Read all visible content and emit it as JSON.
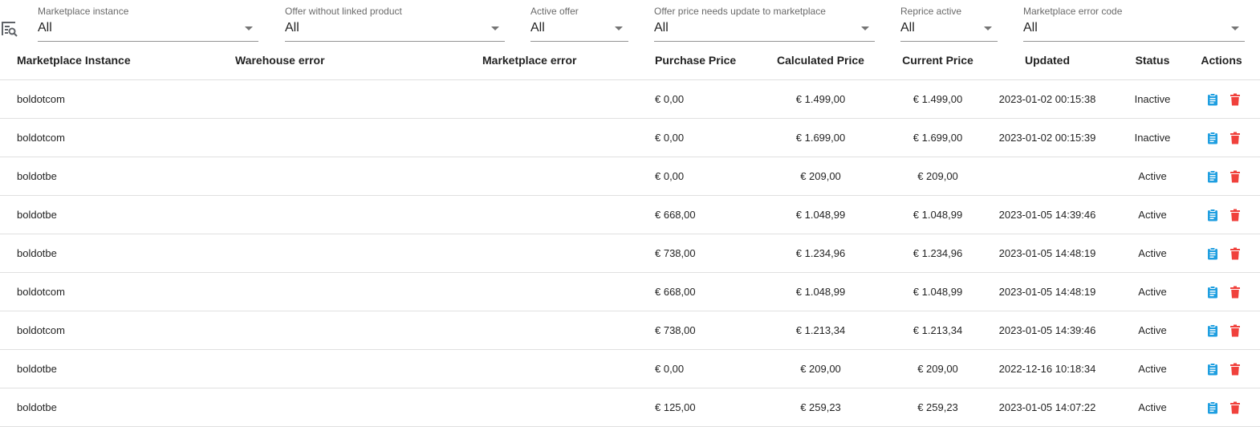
{
  "filters": [
    {
      "label": "Marketplace instance",
      "value": "All"
    },
    {
      "label": "Offer without linked product",
      "value": "All"
    },
    {
      "label": "Active offer",
      "value": "All"
    },
    {
      "label": "Offer price needs update to marketplace",
      "value": "All"
    },
    {
      "label": "Reprice active",
      "value": "All"
    },
    {
      "label": "Marketplace error code",
      "value": "All"
    }
  ],
  "table": {
    "headers": {
      "instance": "Marketplace Instance",
      "warehouse_error": "Warehouse error",
      "marketplace_error": "Marketplace error",
      "purchase_price": "Purchase Price",
      "calculated_price": "Calculated Price",
      "current_price": "Current Price",
      "updated": "Updated",
      "status": "Status",
      "actions": "Actions"
    },
    "rows": [
      {
        "instance": "boldotcom",
        "warehouse_error": "",
        "marketplace_error": "",
        "purchase_price": "€ 0,00",
        "calculated_price": "€ 1.499,00",
        "current_price": "€ 1.499,00",
        "updated": "2023-01-02 00:15:38",
        "status": "Inactive"
      },
      {
        "instance": "boldotcom",
        "warehouse_error": "",
        "marketplace_error": "",
        "purchase_price": "€ 0,00",
        "calculated_price": "€ 1.699,00",
        "current_price": "€ 1.699,00",
        "updated": "2023-01-02 00:15:39",
        "status": "Inactive"
      },
      {
        "instance": "boldotbe",
        "warehouse_error": "",
        "marketplace_error": "",
        "purchase_price": "€ 0,00",
        "calculated_price": "€ 209,00",
        "current_price": "€ 209,00",
        "updated": "",
        "status": "Active"
      },
      {
        "instance": "boldotbe",
        "warehouse_error": "",
        "marketplace_error": "",
        "purchase_price": "€ 668,00",
        "calculated_price": "€ 1.048,99",
        "current_price": "€ 1.048,99",
        "updated": "2023-01-05 14:39:46",
        "status": "Active"
      },
      {
        "instance": "boldotbe",
        "warehouse_error": "",
        "marketplace_error": "",
        "purchase_price": "€ 738,00",
        "calculated_price": "€ 1.234,96",
        "current_price": "€ 1.234,96",
        "updated": "2023-01-05 14:48:19",
        "status": "Active"
      },
      {
        "instance": "boldotcom",
        "warehouse_error": "",
        "marketplace_error": "",
        "purchase_price": "€ 668,00",
        "calculated_price": "€ 1.048,99",
        "current_price": "€ 1.048,99",
        "updated": "2023-01-05 14:48:19",
        "status": "Active"
      },
      {
        "instance": "boldotcom",
        "warehouse_error": "",
        "marketplace_error": "",
        "purchase_price": "€ 738,00",
        "calculated_price": "€ 1.213,34",
        "current_price": "€ 1.213,34",
        "updated": "2023-01-05 14:39:46",
        "status": "Active"
      },
      {
        "instance": "boldotbe",
        "warehouse_error": "",
        "marketplace_error": "",
        "purchase_price": "€ 0,00",
        "calculated_price": "€ 209,00",
        "current_price": "€ 209,00",
        "updated": "2022-12-16 10:18:34",
        "status": "Active"
      },
      {
        "instance": "boldotbe",
        "warehouse_error": "",
        "marketplace_error": "",
        "purchase_price": "€ 125,00",
        "calculated_price": "€ 259,23",
        "current_price": "€ 259,23",
        "updated": "2023-01-05 14:07:22",
        "status": "Active"
      }
    ]
  },
  "icons": {
    "filter": "filter-search-icon",
    "edit": "clipboard-icon",
    "delete": "trash-icon"
  },
  "colors": {
    "edit_icon": "#1e9ee0",
    "delete_icon": "#f0413c",
    "filter_icon": "#5f6368"
  }
}
